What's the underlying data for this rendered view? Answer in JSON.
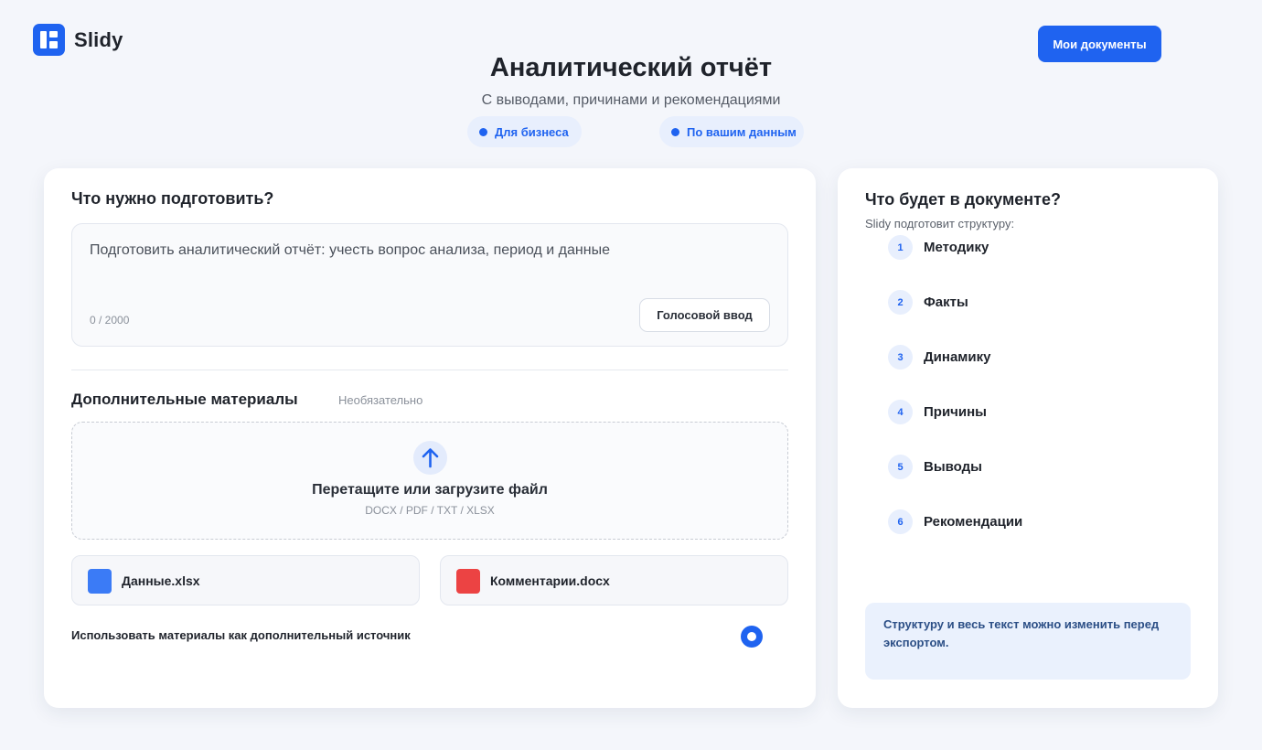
{
  "header": {
    "brand": "Slidy",
    "my_docs_label": "Мои документы"
  },
  "hero": {
    "title": "Аналитический отчёт",
    "subtitle": "С выводами, причинами и рекомендациями",
    "chips": [
      "Для бизнеса",
      "По вашим данным"
    ]
  },
  "request": {
    "heading": "Что нужно подготовить?",
    "input_value": "Подготовить аналитический отчёт: учесть вопрос анализа, период и данные",
    "counter": "0 / 2000",
    "voice_label": "Голосовой ввод"
  },
  "materials": {
    "heading": "Дополнительные материалы",
    "optional": "Необязательно",
    "drop_title": "Перетащите или загрузите файл",
    "drop_formats": "DOCX / PDF / TXT / XLSX",
    "files": [
      {
        "name": "Данные.xlsx",
        "type": "xlsx",
        "color": "#3b7bf6"
      },
      {
        "name": "Комментарии.docx",
        "type": "docx",
        "color": "#ec4343"
      }
    ],
    "use_as_source_label": "Использовать материалы как дополнительный источник",
    "use_as_source_checked": true
  },
  "structure": {
    "heading": "Что будет в документе?",
    "subtitle": "Slidy подготовит структуру:",
    "steps": [
      {
        "num": "1",
        "label": "Методику"
      },
      {
        "num": "2",
        "label": "Факты"
      },
      {
        "num": "3",
        "label": "Динамику"
      },
      {
        "num": "4",
        "label": "Причины"
      },
      {
        "num": "5",
        "label": "Выводы"
      },
      {
        "num": "6",
        "label": "Рекомендации"
      }
    ],
    "note": "Структуру и весь текст можно изменить перед экспортом."
  },
  "colors": {
    "accent": "#1f63f0",
    "background": "#f4f6fb",
    "note_bg": "#eaf1fd"
  }
}
